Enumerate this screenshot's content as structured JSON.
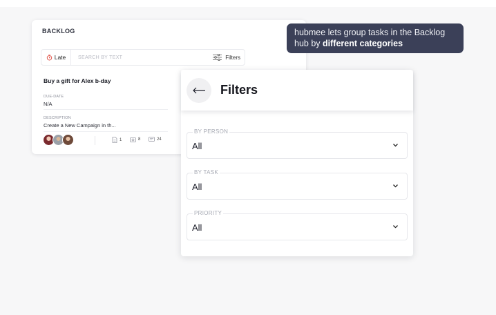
{
  "backlog": {
    "title": "BACKLOG",
    "late_label": "Late",
    "search_placeholder": "SEARCH BY TEXT",
    "filters_label": "Filters",
    "task": {
      "title": "Buy a gift for Alex b-day",
      "due_label": "DUE-DATE",
      "due_value": "N/A",
      "desc_label": "DESCRIPTION",
      "desc_value": "Create a New Campaign in th...",
      "files": "1",
      "photos": "8",
      "comments": "24"
    }
  },
  "tooltip": {
    "text": "hubmee lets group tasks in the Backlog hub by ",
    "bold": "different categories"
  },
  "filters_panel": {
    "title": "Filters",
    "fields": [
      {
        "label": "BY PERSON",
        "value": "All"
      },
      {
        "label": "BY TASK",
        "value": "All"
      },
      {
        "label": "PRIORITY",
        "value": "All"
      }
    ]
  },
  "colors": {
    "tooltip_bg": "#3b4058",
    "late_icon": "#e0483d",
    "stage_bg": "#f7f7f8"
  },
  "icons": [
    "clock-icon",
    "filter-sliders-icon",
    "file-icon",
    "camera-icon",
    "comment-icon",
    "back-arrow-icon",
    "chevron-down-icon"
  ]
}
